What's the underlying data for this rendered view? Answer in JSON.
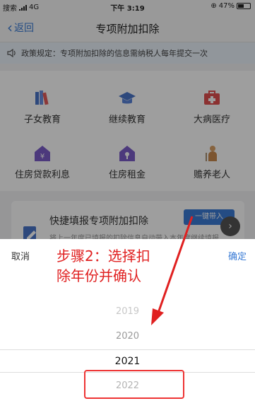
{
  "status_bar": {
    "carrier": "搜索",
    "network": "4G",
    "time": "下午 3:19",
    "battery": "47%"
  },
  "nav": {
    "back_label": "返回",
    "title": "专项附加扣除"
  },
  "notice": {
    "text": "政策规定：专项附加扣除的信息需纳税人每年提交一次"
  },
  "categories": [
    {
      "label": "子女教育",
      "icon": "books-icon"
    },
    {
      "label": "继续教育",
      "icon": "graduation-cap-icon"
    },
    {
      "label": "大病医疗",
      "icon": "medical-kit-icon"
    },
    {
      "label": "住房贷款利息",
      "icon": "house-yen-icon"
    },
    {
      "label": "住房租金",
      "icon": "house-key-icon"
    },
    {
      "label": "赡养老人",
      "icon": "elderly-person-icon"
    }
  ],
  "quick_card": {
    "title": "快捷填报专项附加扣除",
    "button": "一键带入",
    "subtext": "将上一年度已填报的扣除信息自动带入本年度继续填报"
  },
  "picker": {
    "cancel": "取消",
    "confirm": "确定",
    "years": [
      "2019",
      "2020",
      "2021",
      "2022"
    ],
    "selected": "2021"
  },
  "annotation": {
    "line1": "步骤2：选择扣",
    "line2": "除年份并确认"
  },
  "colors": {
    "accent": "#3a7bd5",
    "annotation": "#e02020"
  }
}
